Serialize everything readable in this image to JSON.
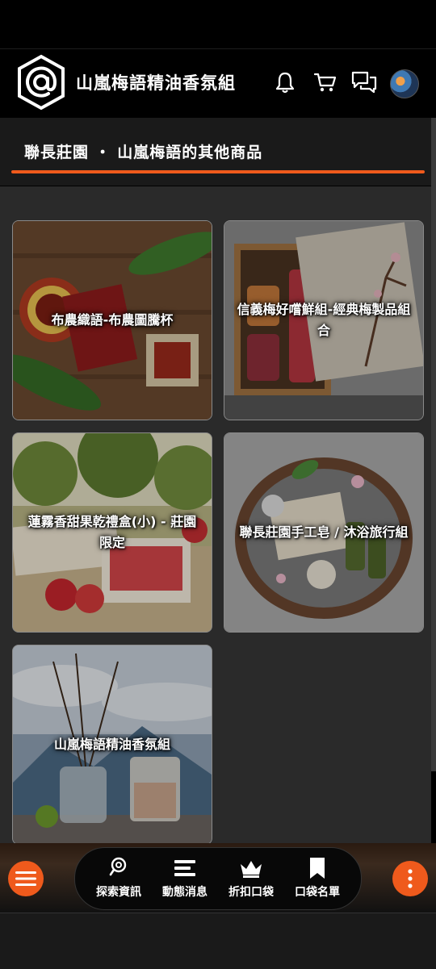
{
  "header": {
    "title": "山嵐梅語精油香氛組",
    "logo_icon": "at-sign-hexagon-logo",
    "icons": [
      "bell-icon",
      "cart-icon",
      "chat-icon"
    ]
  },
  "section": {
    "title": "聯長莊園 ・ 山嵐梅語的其他商品"
  },
  "products": [
    {
      "name": "布農織語-布農圖騰杯"
    },
    {
      "name": "信義梅好嚐鮮組-經典梅製品組合"
    },
    {
      "name": "蓮霧香甜果乾禮盒(小) - 莊園限定"
    },
    {
      "name": "聯長莊園手工皂 / 沐浴旅行組"
    },
    {
      "name": "山嵐梅語精油香氛組"
    }
  ],
  "bottom_nav": [
    {
      "label": "探索資訊",
      "icon": "map-pin-search-icon"
    },
    {
      "label": "動態消息",
      "icon": "feed-lines-icon"
    },
    {
      "label": "折扣口袋",
      "icon": "crown-icon"
    },
    {
      "label": "口袋名單",
      "icon": "bookmark-icon"
    }
  ],
  "colors": {
    "accent": "#ef5a1c",
    "background": "#000000",
    "content": "#2a2a2a"
  }
}
